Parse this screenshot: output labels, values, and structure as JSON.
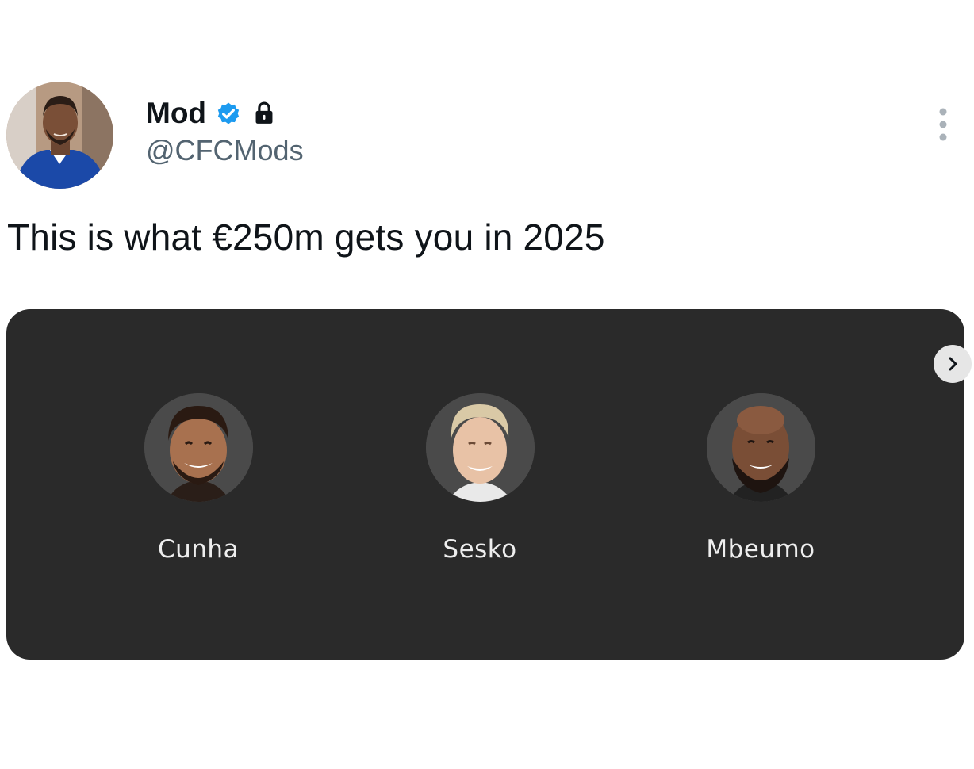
{
  "author": {
    "display_name": "Mod",
    "handle": "@CFCMods",
    "verified_icon": "verified-badge-icon",
    "locked_icon": "lock-icon",
    "avatar": "avatar"
  },
  "menu": {
    "icon": "more-vertical-icon"
  },
  "tweet": {
    "text": "This is what €250m gets you in 2025"
  },
  "card": {
    "players": [
      {
        "name": "Cunha"
      },
      {
        "name": "Sesko"
      },
      {
        "name": "Mbeumo"
      }
    ],
    "next_icon": "chevron-right-icon"
  },
  "colors": {
    "verified": "#1d9bf0",
    "card_background": "#2a2a2a",
    "handle": "#536471",
    "text": "#0f1419"
  }
}
